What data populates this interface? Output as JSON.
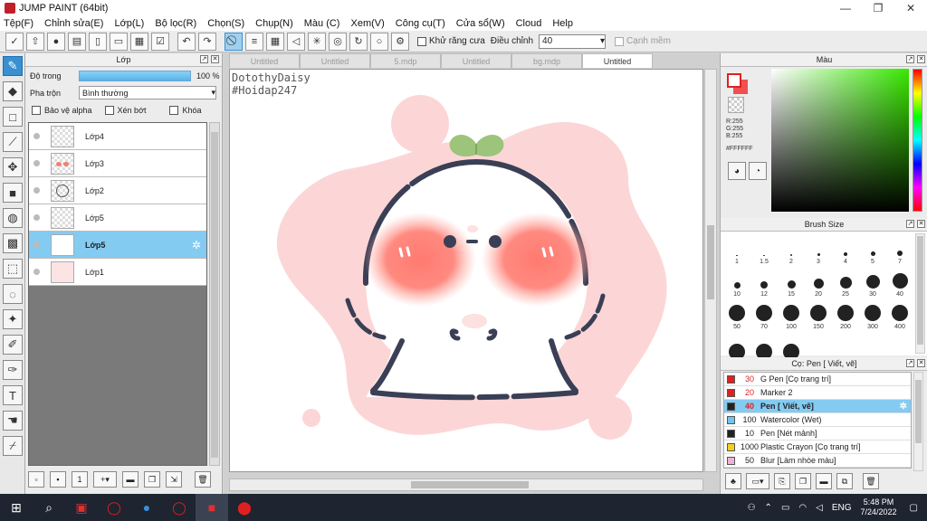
{
  "app": {
    "title": "JUMP PAINT (64bit)",
    "win_min": "—",
    "win_max": "❐",
    "win_close": "✕"
  },
  "menu": [
    "Tệp(F)",
    "Chỉnh sửa(E)",
    "Lớp(L)",
    "Bộ lọc(R)",
    "Chọn(S)",
    "Chụp(N)",
    "Màu (C)",
    "Xem(V)",
    "Công cụ(T)",
    "Cửa sổ(W)",
    "Cloud",
    "Help"
  ],
  "toolbar": {
    "antialias_label": "Khử răng cưa",
    "adjust_label": "Điều chỉnh",
    "adjust_value": "40",
    "edge_label": "Cạnh mềm"
  },
  "layer_panel": {
    "title": "Lớp",
    "opacity_label": "Độ trong",
    "opacity_value": "100 %",
    "opacity_fraction": 1.0,
    "blend_label": "Pha trộn",
    "blend_value": "Bình thường",
    "protect_alpha": "Bảo vệ alpha",
    "clip": "Xén bớt",
    "lock": "Khóa",
    "layers": [
      {
        "name": "Lớp4",
        "selected": false
      },
      {
        "name": "Lớp3",
        "selected": false
      },
      {
        "name": "Lớp2",
        "selected": false
      },
      {
        "name": "Lớp5",
        "selected": false
      },
      {
        "name": "Lớp5",
        "selected": true
      },
      {
        "name": "Lớp1",
        "selected": false
      }
    ]
  },
  "tabs": [
    {
      "label": "Untitled",
      "active": false
    },
    {
      "label": "Untitled",
      "active": false
    },
    {
      "label": "5.mdp",
      "active": false
    },
    {
      "label": "Untitled",
      "active": false
    },
    {
      "label": "bg.mdp",
      "active": false
    },
    {
      "label": "Untitled",
      "active": true
    }
  ],
  "canvas": {
    "watermark_line1": "DotothyDaisy",
    "watermark_line2": "#Hoidap247"
  },
  "color_panel": {
    "title": "Màu",
    "r": "R:255",
    "g": "G:255",
    "b": "B:255",
    "hex": "#FFFFFF",
    "front_color": "#FFFFFF",
    "back_color": "#F05050"
  },
  "brush_panel": {
    "title": "Brush Size",
    "sizes": [
      "1",
      "1.5",
      "2",
      "3",
      "4",
      "5",
      "7",
      "10",
      "12",
      "15",
      "20",
      "25",
      "30",
      "40",
      "50",
      "70",
      "100",
      "150",
      "200",
      "300",
      "400",
      "",
      "",
      ""
    ]
  },
  "tool_panel": {
    "title": "Cọ: Pen [ Viết, vẽ]",
    "tools": [
      {
        "size": "30",
        "name": "G Pen [Cọ trang trí]",
        "color": "#e02020",
        "selected": false
      },
      {
        "size": "20",
        "name": "Marker 2",
        "color": "#e02020",
        "selected": false
      },
      {
        "size": "40",
        "name": "Pen [ Viết, vẽ]",
        "color": "#222222",
        "selected": true
      },
      {
        "size": "100",
        "name": "Watercolor (Wet)",
        "color": "#6cc8f0",
        "selected": false
      },
      {
        "size": "10",
        "name": "Pen [Nét mảnh]",
        "color": "#222222",
        "selected": false
      },
      {
        "size": "1000",
        "name": "Plastic Crayon [Cọ trang trí]",
        "color": "#f0d020",
        "selected": false
      },
      {
        "size": "50",
        "name": "Blur [Làm nhòe màu]",
        "color": "#f0b0d8",
        "selected": false
      }
    ]
  },
  "taskbar": {
    "lang": "ENG",
    "time": "5:48 PM",
    "date": "7/24/2022"
  }
}
